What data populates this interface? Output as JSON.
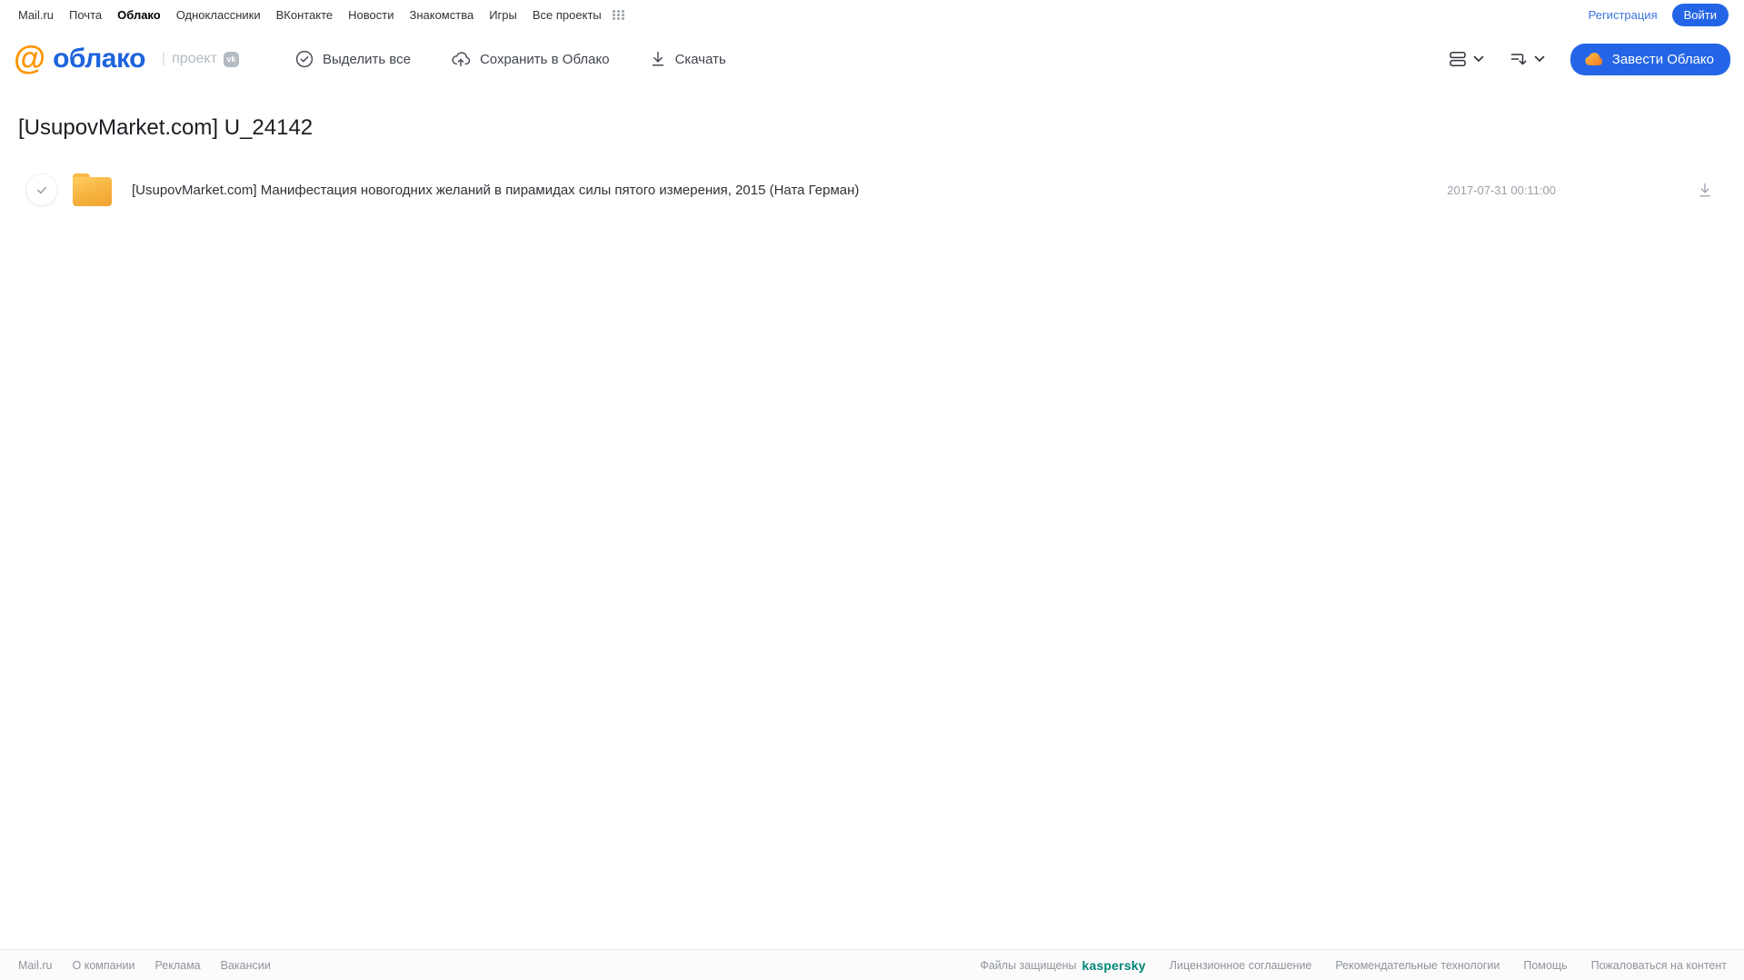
{
  "topbar": {
    "links": [
      "Mail.ru",
      "Почта",
      "Облако",
      "Одноклассники",
      "ВКонтакте",
      "Новости",
      "Знакомства",
      "Игры",
      "Все проекты"
    ],
    "active_link": "Облако",
    "register_label": "Регистрация",
    "login_label": "Войти"
  },
  "header": {
    "logo_at": "@",
    "logo_text": "облако",
    "logo_separator": "|",
    "project_label": "проект",
    "vk_badge": "vk",
    "toolbar": {
      "select_all_label": "Выделить все",
      "save_to_cloud_label": "Сохранить в Облако",
      "download_label": "Скачать"
    },
    "get_cloud_label": "Завести Облако"
  },
  "main": {
    "title": "[UsupovMarket.com] U_24142",
    "files": [
      {
        "name": "[UsupovMarket.com] Манифестация новогодних желаний в пирамидах силы пятого измерения, 2015 (Ната Герман)",
        "date": "2017-07-31 00:11:00"
      }
    ]
  },
  "footer": {
    "left_links": [
      "Mail.ru",
      "О компании",
      "Реклама",
      "Вакансии"
    ],
    "protected_text": "Файлы защищены",
    "kaspersky_label": "kaspersky",
    "right_links": [
      "Лицензионное соглашение",
      "Рекомендательные технологии",
      "Помощь",
      "Пожаловаться на контент"
    ]
  },
  "icons": {
    "select_all": "check-circle",
    "save_to_cloud": "cloud-upload",
    "download": "arrow-down-to-line",
    "view_mode": "list-view",
    "sort": "sort-lines-arrow",
    "apps": "grid-3x3-dots",
    "get_cloud": "orange-cloud",
    "row_checkbox": "check-circle",
    "folder": "yellow-folder"
  },
  "colors": {
    "accent_blue": "#2365e6",
    "logo_blue": "#1d63dc",
    "logo_orange": "#ff9400",
    "kaspersky_green": "#008575",
    "folder_orange": "#f6b23f",
    "muted_grey": "#9ca1a8"
  }
}
